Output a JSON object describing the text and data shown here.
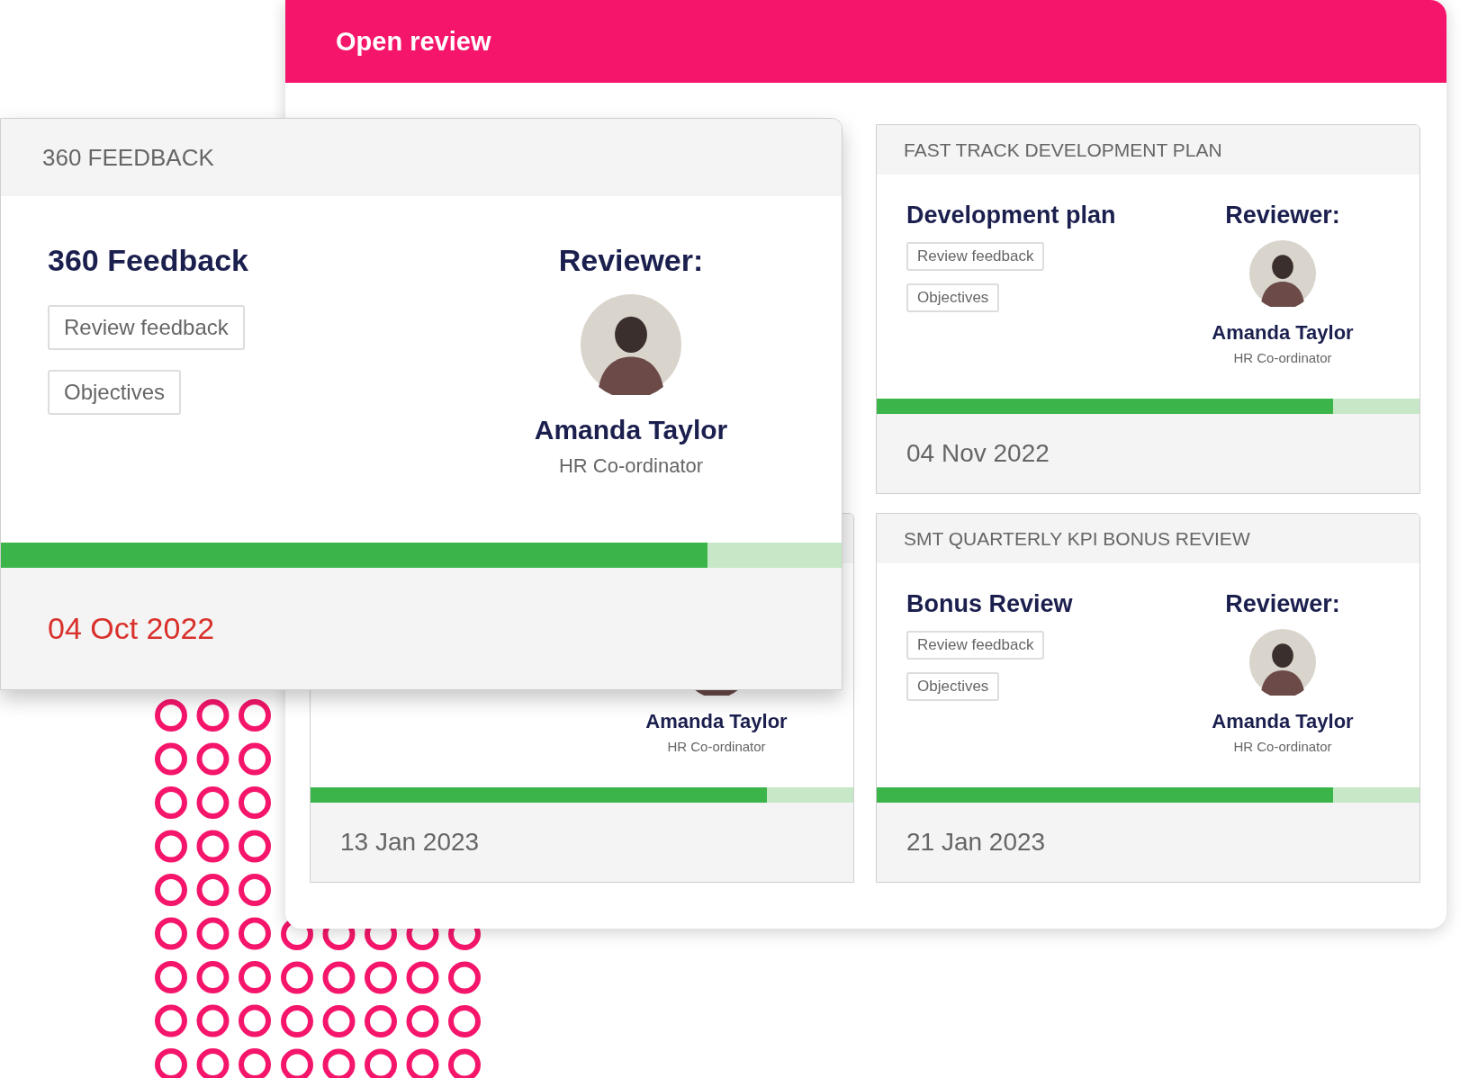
{
  "open_review": {
    "title": "Open review",
    "cards": [
      {
        "reviewer": {
          "name": "Amanda Taylor",
          "role": "HR Co-ordinator"
        },
        "level": 0.84,
        "date": "13 Jan 2023",
        "overdue": false
      },
      {
        "title": "FAST TRACK DEVELOPMENT PLAN",
        "heading": "Development plan",
        "buttons": [
          "Review feedback",
          "Objectives"
        ],
        "reviewer_label": "Reviewer:",
        "reviewer": {
          "name": "Amanda Taylor",
          "role": "HR Co-ordinator"
        },
        "level": 0.84,
        "date": "04 Nov 2022",
        "overdue": false
      },
      {
        "title": "SMT QUARTERLY KPI BONUS REVIEW",
        "heading": "Bonus Review",
        "buttons": [
          "Review feedback",
          "Objectives"
        ],
        "reviewer_label": "Reviewer:",
        "reviewer": {
          "name": "Amanda Taylor",
          "role": "HR Co-ordinator"
        },
        "level": 0.84,
        "date": "21 Jan 2023",
        "overdue": false
      }
    ]
  },
  "featured_card": {
    "title": "360 FEEDBACK",
    "heading": "360 Feedback",
    "buttons": [
      "Review feedback",
      "Objectives"
    ],
    "reviewer_label": "Reviewer:",
    "reviewer": {
      "name": "Amanda Taylor",
      "role": "HR Co-ordinator"
    },
    "level": 0.84,
    "date": "04 Oct 2022",
    "overdue": true
  }
}
